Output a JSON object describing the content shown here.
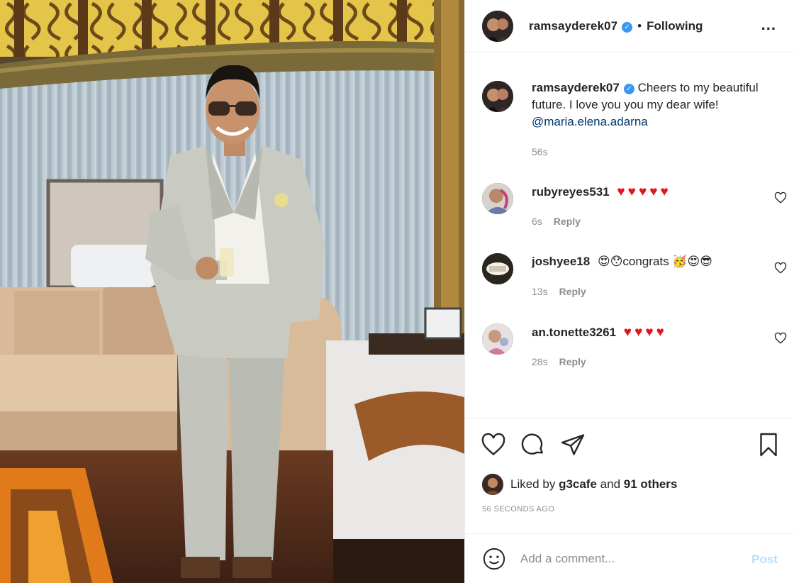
{
  "header": {
    "username": "ramsayderek07",
    "dot": "•",
    "follow_status": "Following",
    "more_label": "..."
  },
  "caption": {
    "username": "ramsayderek07",
    "text": "Cheers to my beautiful future. I love you you my dear wife!",
    "mention": "@maria.elena.adarna",
    "time": "56s"
  },
  "comments": [
    {
      "username": "rubyreyes531",
      "text": "❤️❤️❤️❤️❤️",
      "hearts": 5,
      "time": "6s",
      "reply": "Reply"
    },
    {
      "username": "joshyee18",
      "emoji_before": "😍😯",
      "text": "congrats",
      "emoji_after": "🥳😍😎",
      "time": "13s",
      "reply": "Reply"
    },
    {
      "username": "an.tonette3261",
      "text": "❤️❤️❤️❤️",
      "hearts": 4,
      "time": "28s",
      "reply": "Reply"
    }
  ],
  "actions": {
    "like_icon": "heart-outline-icon",
    "comment_icon": "comment-bubble-icon",
    "share_icon": "paper-plane-icon",
    "save_icon": "bookmark-icon"
  },
  "likes": {
    "prefix": "Liked by",
    "user": "g3cafe",
    "connector": "and",
    "others": "91 others"
  },
  "time_ago": "56 SECONDS AGO",
  "add_comment": {
    "placeholder": "Add a comment...",
    "post_label": "Post"
  },
  "colors": {
    "verified": "#3897f0",
    "link": "#00376b",
    "muted": "#8e8e8e",
    "post_disabled": "#b2dffc",
    "heart": "#e0141e"
  }
}
